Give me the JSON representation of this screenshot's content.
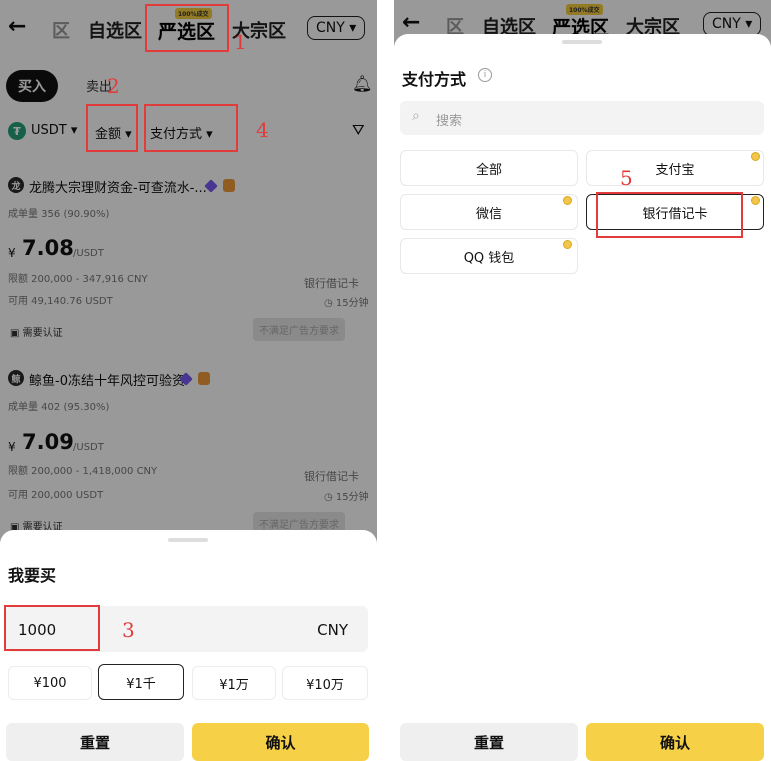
{
  "left": {
    "header": {
      "tabs": [
        "区",
        "自选区",
        "严选区",
        "大宗区"
      ],
      "badge": "100%成交",
      "currency_button": "CNY ▾"
    },
    "trade_toggle": {
      "buy": "买入",
      "sell": "卖出"
    },
    "filters": {
      "coin": "USDT",
      "amount": "金额",
      "payment": "支付方式"
    },
    "listings": [
      {
        "avatar": "龙",
        "merchant": "龙腾大宗理财资金-可查流水-...",
        "orders": "成单量 356 (90.90%)",
        "price_symbol": "¥",
        "price": "7.08",
        "price_unit": "/USDT",
        "limit": "限额 200,000 - 347,916 CNY",
        "available": "可用 49,140.76 USDT",
        "method": "银行借记卡",
        "time": "15分钟",
        "verify": "需要认证",
        "action": "不满足广告方要求"
      },
      {
        "avatar": "鲸",
        "merchant": "鲸鱼-0冻结十年风控可验资",
        "orders": "成单量 402 (95.30%)",
        "price_symbol": "¥",
        "price": "7.09",
        "price_unit": "/USDT",
        "limit": "限额 200,000 - 1,418,000 CNY",
        "available": "可用 200,000 USDT",
        "method": "银行借记卡",
        "time": "15分钟",
        "verify": "需要认证",
        "action": "不满足广告方要求"
      }
    ],
    "sheet": {
      "title": "我要买",
      "amount_value": "1000",
      "currency": "CNY",
      "quick_amounts": [
        "¥100",
        "¥1千",
        "¥1万",
        "¥10万"
      ],
      "selected_quick": 1,
      "reset": "重置",
      "confirm": "确认"
    },
    "annotations": [
      "1",
      "2",
      "3",
      "4"
    ]
  },
  "right": {
    "header": {
      "tabs": [
        "区",
        "自选区",
        "严选区",
        "大宗区"
      ],
      "badge": "100%成交",
      "currency_button": "CNY ▾"
    },
    "sheet": {
      "title": "支付方式",
      "search_placeholder": "搜索",
      "options": [
        "全部",
        "支付宝",
        "微信",
        "银行借记卡",
        "QQ 钱包"
      ],
      "selected": "银行借记卡",
      "reset": "重置",
      "confirm": "确认"
    },
    "annotations": [
      "5"
    ]
  },
  "colors": {
    "accent": "#f6d046",
    "annotation": "#e23b3b",
    "dim": "rgba(0,0,0,0.40)"
  }
}
